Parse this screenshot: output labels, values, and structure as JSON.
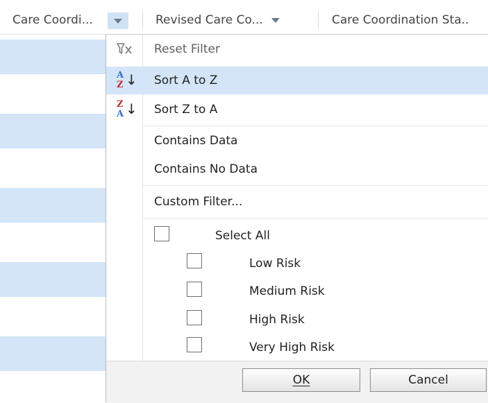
{
  "columns": [
    {
      "label": "Care Coordi..."
    },
    {
      "label": "Revised Care Co..."
    },
    {
      "label": "Care Coordination Sta.."
    }
  ],
  "menu": {
    "reset_filter": "Reset Filter",
    "sort_asc": "Sort A to Z",
    "sort_desc": "Sort Z to A",
    "contains_data": "Contains Data",
    "contains_no_data": "Contains No Data",
    "custom_filter": "Custom Filter...",
    "select_all": "Select All",
    "options": [
      "Low Risk",
      "Medium Risk",
      "High Risk",
      "Very High Risk"
    ]
  },
  "icons": {
    "sort_asc_top": "A",
    "sort_asc_bottom": "Z",
    "sort_desc_top": "Z",
    "sort_desc_bottom": "A",
    "arrow": "↓"
  },
  "buttons": {
    "ok": "OK",
    "cancel": "Cancel"
  },
  "colors": {
    "highlight": "#d3e5f7",
    "sort_blue": "#2f6fcf",
    "sort_red": "#c52a2a"
  }
}
